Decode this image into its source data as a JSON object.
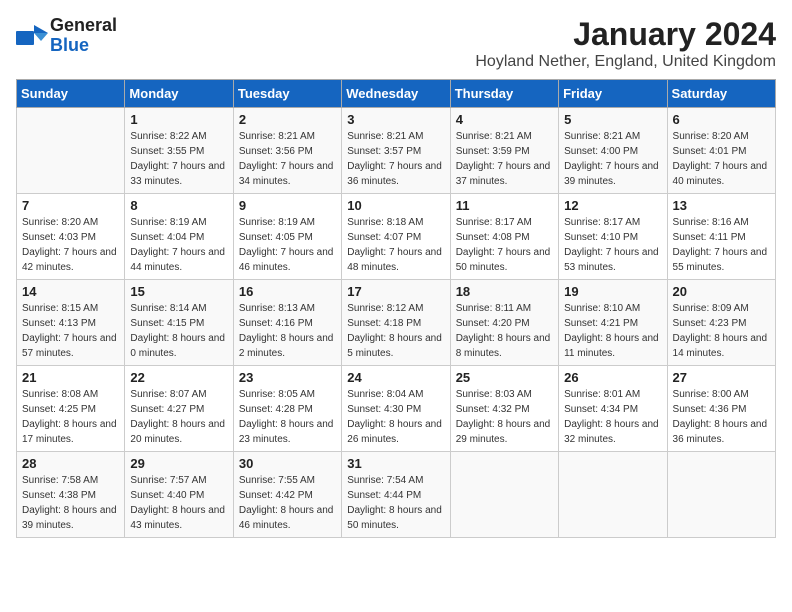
{
  "logo": {
    "line1": "General",
    "line2": "Blue"
  },
  "title": "January 2024",
  "subtitle": "Hoyland Nether, England, United Kingdom",
  "days_of_week": [
    "Sunday",
    "Monday",
    "Tuesday",
    "Wednesday",
    "Thursday",
    "Friday",
    "Saturday"
  ],
  "weeks": [
    [
      {
        "day": "",
        "sunrise": "",
        "sunset": "",
        "daylight": ""
      },
      {
        "day": "1",
        "sunrise": "Sunrise: 8:22 AM",
        "sunset": "Sunset: 3:55 PM",
        "daylight": "Daylight: 7 hours and 33 minutes."
      },
      {
        "day": "2",
        "sunrise": "Sunrise: 8:21 AM",
        "sunset": "Sunset: 3:56 PM",
        "daylight": "Daylight: 7 hours and 34 minutes."
      },
      {
        "day": "3",
        "sunrise": "Sunrise: 8:21 AM",
        "sunset": "Sunset: 3:57 PM",
        "daylight": "Daylight: 7 hours and 36 minutes."
      },
      {
        "day": "4",
        "sunrise": "Sunrise: 8:21 AM",
        "sunset": "Sunset: 3:59 PM",
        "daylight": "Daylight: 7 hours and 37 minutes."
      },
      {
        "day": "5",
        "sunrise": "Sunrise: 8:21 AM",
        "sunset": "Sunset: 4:00 PM",
        "daylight": "Daylight: 7 hours and 39 minutes."
      },
      {
        "day": "6",
        "sunrise": "Sunrise: 8:20 AM",
        "sunset": "Sunset: 4:01 PM",
        "daylight": "Daylight: 7 hours and 40 minutes."
      }
    ],
    [
      {
        "day": "7",
        "sunrise": "Sunrise: 8:20 AM",
        "sunset": "Sunset: 4:03 PM",
        "daylight": "Daylight: 7 hours and 42 minutes."
      },
      {
        "day": "8",
        "sunrise": "Sunrise: 8:19 AM",
        "sunset": "Sunset: 4:04 PM",
        "daylight": "Daylight: 7 hours and 44 minutes."
      },
      {
        "day": "9",
        "sunrise": "Sunrise: 8:19 AM",
        "sunset": "Sunset: 4:05 PM",
        "daylight": "Daylight: 7 hours and 46 minutes."
      },
      {
        "day": "10",
        "sunrise": "Sunrise: 8:18 AM",
        "sunset": "Sunset: 4:07 PM",
        "daylight": "Daylight: 7 hours and 48 minutes."
      },
      {
        "day": "11",
        "sunrise": "Sunrise: 8:17 AM",
        "sunset": "Sunset: 4:08 PM",
        "daylight": "Daylight: 7 hours and 50 minutes."
      },
      {
        "day": "12",
        "sunrise": "Sunrise: 8:17 AM",
        "sunset": "Sunset: 4:10 PM",
        "daylight": "Daylight: 7 hours and 53 minutes."
      },
      {
        "day": "13",
        "sunrise": "Sunrise: 8:16 AM",
        "sunset": "Sunset: 4:11 PM",
        "daylight": "Daylight: 7 hours and 55 minutes."
      }
    ],
    [
      {
        "day": "14",
        "sunrise": "Sunrise: 8:15 AM",
        "sunset": "Sunset: 4:13 PM",
        "daylight": "Daylight: 7 hours and 57 minutes."
      },
      {
        "day": "15",
        "sunrise": "Sunrise: 8:14 AM",
        "sunset": "Sunset: 4:15 PM",
        "daylight": "Daylight: 8 hours and 0 minutes."
      },
      {
        "day": "16",
        "sunrise": "Sunrise: 8:13 AM",
        "sunset": "Sunset: 4:16 PM",
        "daylight": "Daylight: 8 hours and 2 minutes."
      },
      {
        "day": "17",
        "sunrise": "Sunrise: 8:12 AM",
        "sunset": "Sunset: 4:18 PM",
        "daylight": "Daylight: 8 hours and 5 minutes."
      },
      {
        "day": "18",
        "sunrise": "Sunrise: 8:11 AM",
        "sunset": "Sunset: 4:20 PM",
        "daylight": "Daylight: 8 hours and 8 minutes."
      },
      {
        "day": "19",
        "sunrise": "Sunrise: 8:10 AM",
        "sunset": "Sunset: 4:21 PM",
        "daylight": "Daylight: 8 hours and 11 minutes."
      },
      {
        "day": "20",
        "sunrise": "Sunrise: 8:09 AM",
        "sunset": "Sunset: 4:23 PM",
        "daylight": "Daylight: 8 hours and 14 minutes."
      }
    ],
    [
      {
        "day": "21",
        "sunrise": "Sunrise: 8:08 AM",
        "sunset": "Sunset: 4:25 PM",
        "daylight": "Daylight: 8 hours and 17 minutes."
      },
      {
        "day": "22",
        "sunrise": "Sunrise: 8:07 AM",
        "sunset": "Sunset: 4:27 PM",
        "daylight": "Daylight: 8 hours and 20 minutes."
      },
      {
        "day": "23",
        "sunrise": "Sunrise: 8:05 AM",
        "sunset": "Sunset: 4:28 PM",
        "daylight": "Daylight: 8 hours and 23 minutes."
      },
      {
        "day": "24",
        "sunrise": "Sunrise: 8:04 AM",
        "sunset": "Sunset: 4:30 PM",
        "daylight": "Daylight: 8 hours and 26 minutes."
      },
      {
        "day": "25",
        "sunrise": "Sunrise: 8:03 AM",
        "sunset": "Sunset: 4:32 PM",
        "daylight": "Daylight: 8 hours and 29 minutes."
      },
      {
        "day": "26",
        "sunrise": "Sunrise: 8:01 AM",
        "sunset": "Sunset: 4:34 PM",
        "daylight": "Daylight: 8 hours and 32 minutes."
      },
      {
        "day": "27",
        "sunrise": "Sunrise: 8:00 AM",
        "sunset": "Sunset: 4:36 PM",
        "daylight": "Daylight: 8 hours and 36 minutes."
      }
    ],
    [
      {
        "day": "28",
        "sunrise": "Sunrise: 7:58 AM",
        "sunset": "Sunset: 4:38 PM",
        "daylight": "Daylight: 8 hours and 39 minutes."
      },
      {
        "day": "29",
        "sunrise": "Sunrise: 7:57 AM",
        "sunset": "Sunset: 4:40 PM",
        "daylight": "Daylight: 8 hours and 43 minutes."
      },
      {
        "day": "30",
        "sunrise": "Sunrise: 7:55 AM",
        "sunset": "Sunset: 4:42 PM",
        "daylight": "Daylight: 8 hours and 46 minutes."
      },
      {
        "day": "31",
        "sunrise": "Sunrise: 7:54 AM",
        "sunset": "Sunset: 4:44 PM",
        "daylight": "Daylight: 8 hours and 50 minutes."
      },
      {
        "day": "",
        "sunrise": "",
        "sunset": "",
        "daylight": ""
      },
      {
        "day": "",
        "sunrise": "",
        "sunset": "",
        "daylight": ""
      },
      {
        "day": "",
        "sunrise": "",
        "sunset": "",
        "daylight": ""
      }
    ]
  ]
}
